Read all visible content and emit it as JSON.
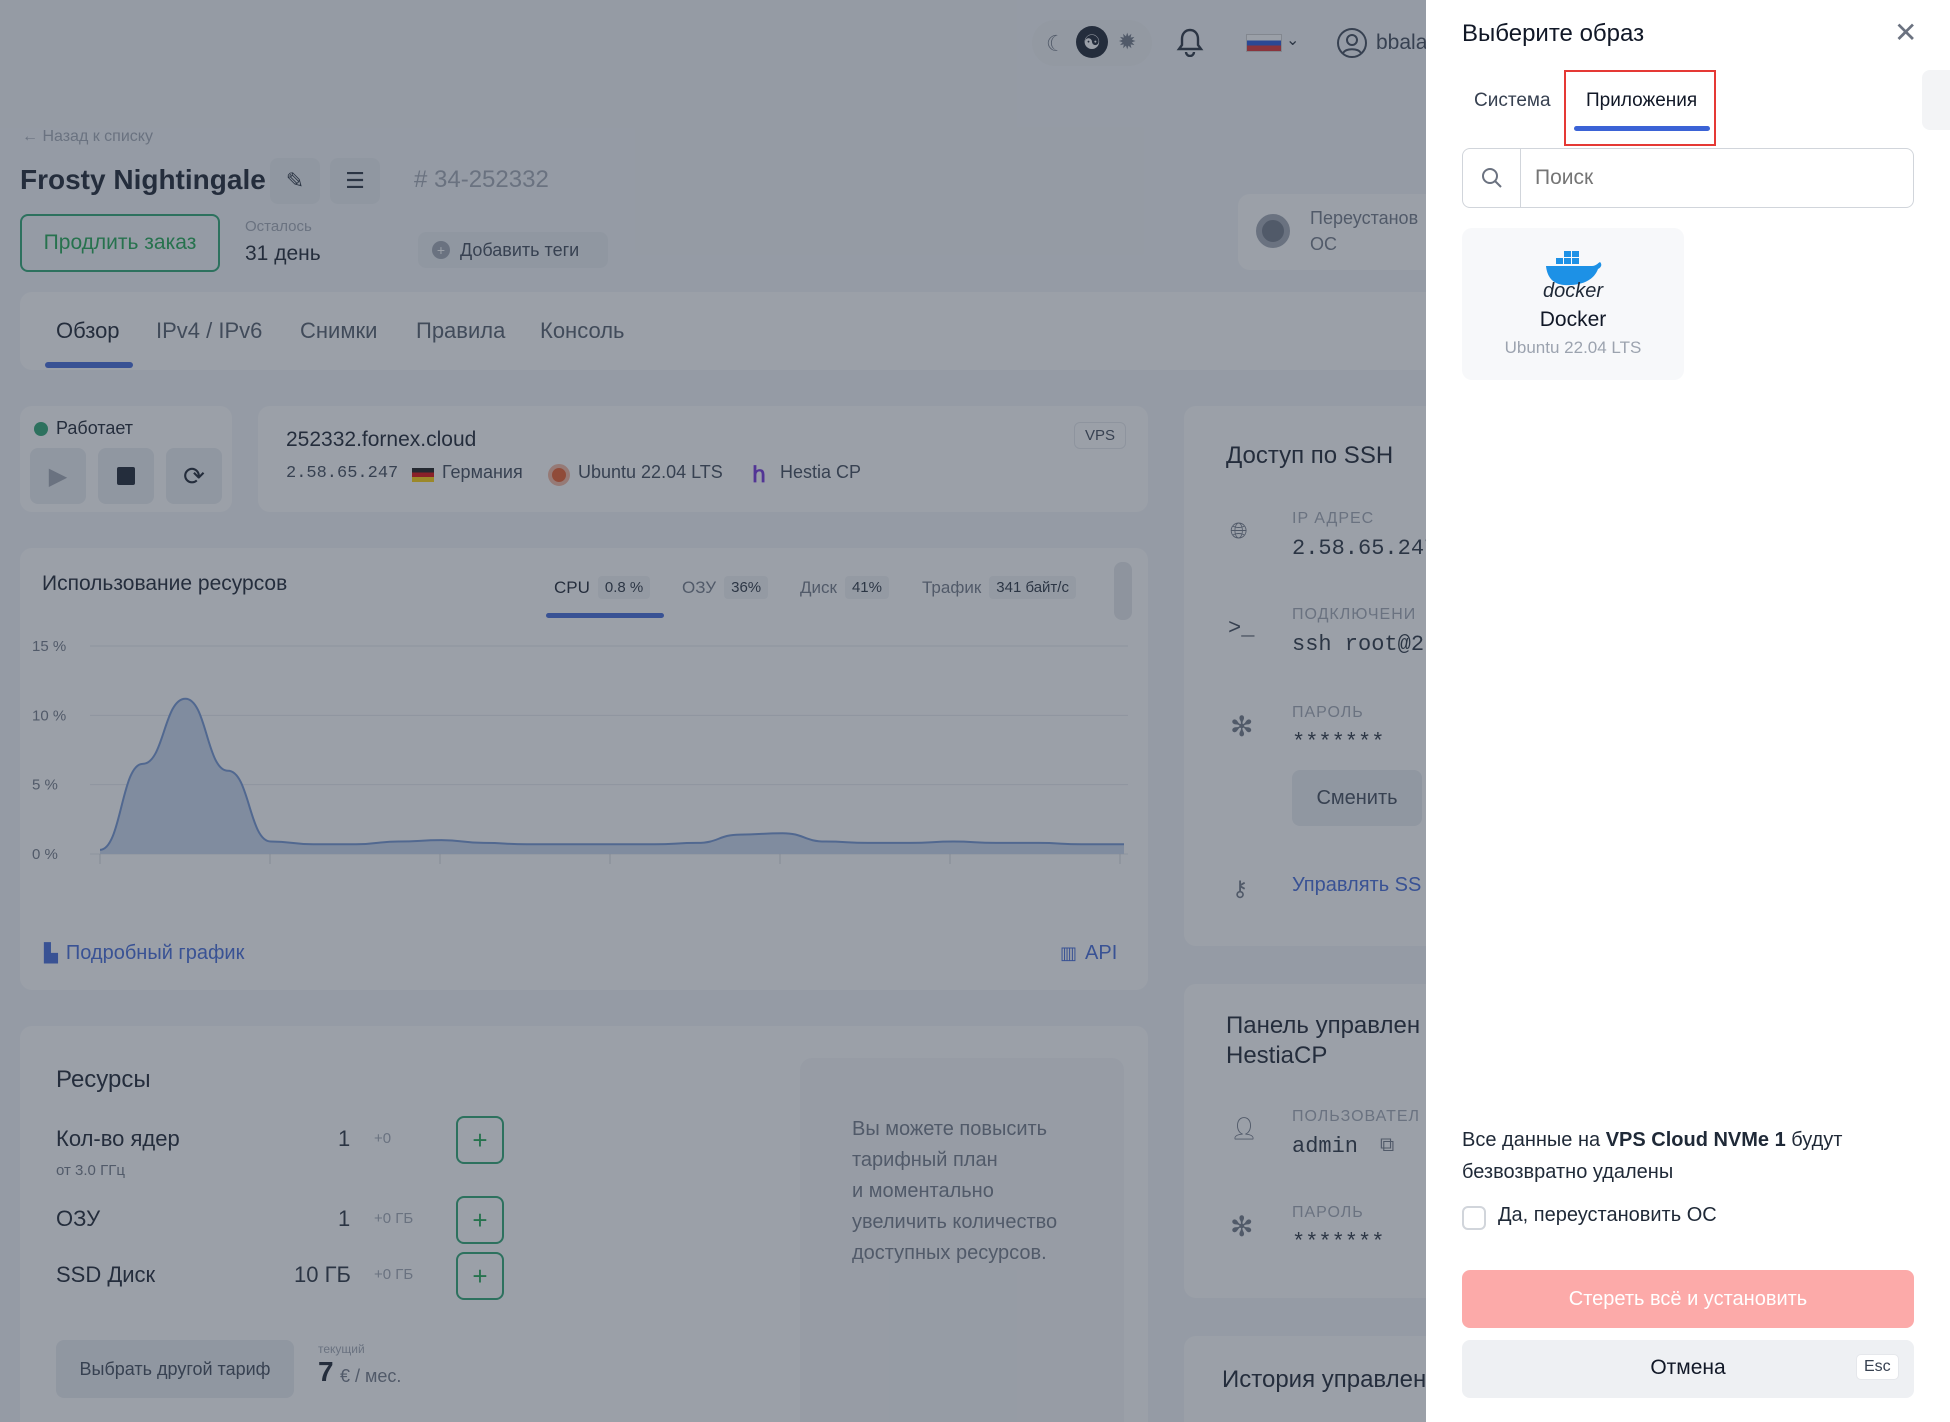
{
  "header": {
    "user": "bbala",
    "back_link": "← Назад к списку"
  },
  "server": {
    "name": "Frosty Nightingale",
    "id": "# 34-252332",
    "extend_button": "Продлить заказ",
    "remaining_label": "Осталось",
    "remaining_value": "31 день",
    "add_tags": "Добавить теги",
    "reinstall_label_line1": "Переустанов",
    "reinstall_label_line2": "ОС"
  },
  "tabs": [
    "Обзор",
    "IPv4 / IPv6",
    "Снимки",
    "Правила",
    "Консоль"
  ],
  "status": {
    "label": "Работает"
  },
  "info": {
    "hostname": "252332.fornex.cloud",
    "badge": "VPS",
    "ip": "2.58.65.247",
    "country": "Германия",
    "os": "Ubuntu 22.04 LTS",
    "panel": "Hestia CP"
  },
  "usage": {
    "title": "Использование ресурсов",
    "metrics": [
      {
        "label": "CPU",
        "value": "0.8 %"
      },
      {
        "label": "ОЗУ",
        "value": "36%"
      },
      {
        "label": "Диск",
        "value": "41%"
      },
      {
        "label": "Трафик",
        "value": "341 байт/с"
      }
    ],
    "detail_link": "Подробный график",
    "api_link": "API"
  },
  "chart_data": {
    "type": "area",
    "y_ticks": [
      "15 %",
      "10 %",
      "5 %",
      "0 %"
    ],
    "ylim": [
      0,
      15
    ],
    "x": [
      0,
      1,
      2,
      3,
      4,
      5,
      6,
      7,
      8,
      9,
      10,
      11,
      12,
      13,
      14,
      15,
      16,
      17,
      18,
      19,
      20,
      21,
      22,
      23,
      24
    ],
    "values": [
      0.3,
      6.5,
      11.2,
      6.0,
      0.9,
      0.7,
      0.7,
      0.9,
      1.0,
      0.8,
      0.7,
      0.7,
      0.7,
      0.7,
      0.8,
      1.4,
      1.5,
      0.9,
      0.8,
      0.8,
      0.9,
      0.8,
      0.8,
      0.7,
      0.7
    ]
  },
  "ssh": {
    "title": "Доступ по SSH",
    "ip_label": "IP адрес",
    "ip_value": "2.58.65.247",
    "conn_label": "подключени",
    "conn_value": "ssh root@2.",
    "pass_label": "Пароль",
    "pass_value": "*******",
    "change_button": "Сменить",
    "manage_link": "Управлять SS"
  },
  "panel": {
    "title_line1": "Панель управлен",
    "title_line2": "HestiaCP",
    "user_label": "пользовател",
    "user_value": "admin",
    "pass_label": "Пароль",
    "pass_value": "*******"
  },
  "history": {
    "title": "История управлен"
  },
  "resources": {
    "title": "Ресурсы",
    "rows": [
      {
        "label": "Кол-во ядер",
        "sub": "от 3.0 ГГц",
        "value": "1",
        "delta": "+0"
      },
      {
        "label": "ОЗУ",
        "sub": "",
        "value": "1",
        "delta": "+0 ГБ"
      },
      {
        "label": "SSD Диск",
        "sub": "",
        "value": "10 ГБ",
        "delta": "+0 ГБ"
      }
    ],
    "upgrade_text_lines": [
      "Вы можете повысить",
      "тарифный план",
      "и моментально",
      "увеличить количество",
      "доступных ресурсов."
    ],
    "choose_plan": "Выбрать другой тариф",
    "current_label": "текущий",
    "price_value": "7",
    "price_unit": "€ / мес."
  },
  "drawer": {
    "title": "Выберите образ",
    "tabs": [
      "Система",
      "Приложения"
    ],
    "search_placeholder": "Поиск",
    "image": {
      "logo_text": "docker",
      "name": "Docker",
      "os": "Ubuntu 22.04 LTS"
    },
    "warning_prefix": "Все данные на ",
    "warning_bold": "VPS Cloud NVMe 1",
    "warning_suffix": " будут",
    "warning_line2": "безвозвратно удалены",
    "confirm_label": "Да, переустановить ОС",
    "erase_button": "Стереть всё и установить",
    "cancel_button": "Отмена",
    "esc_hint": "Esc"
  },
  "colors": {
    "accent_blue": "#3b63d6",
    "green": "#22a06b",
    "erase_red": "#f87171",
    "highlight_red": "#e53935"
  }
}
